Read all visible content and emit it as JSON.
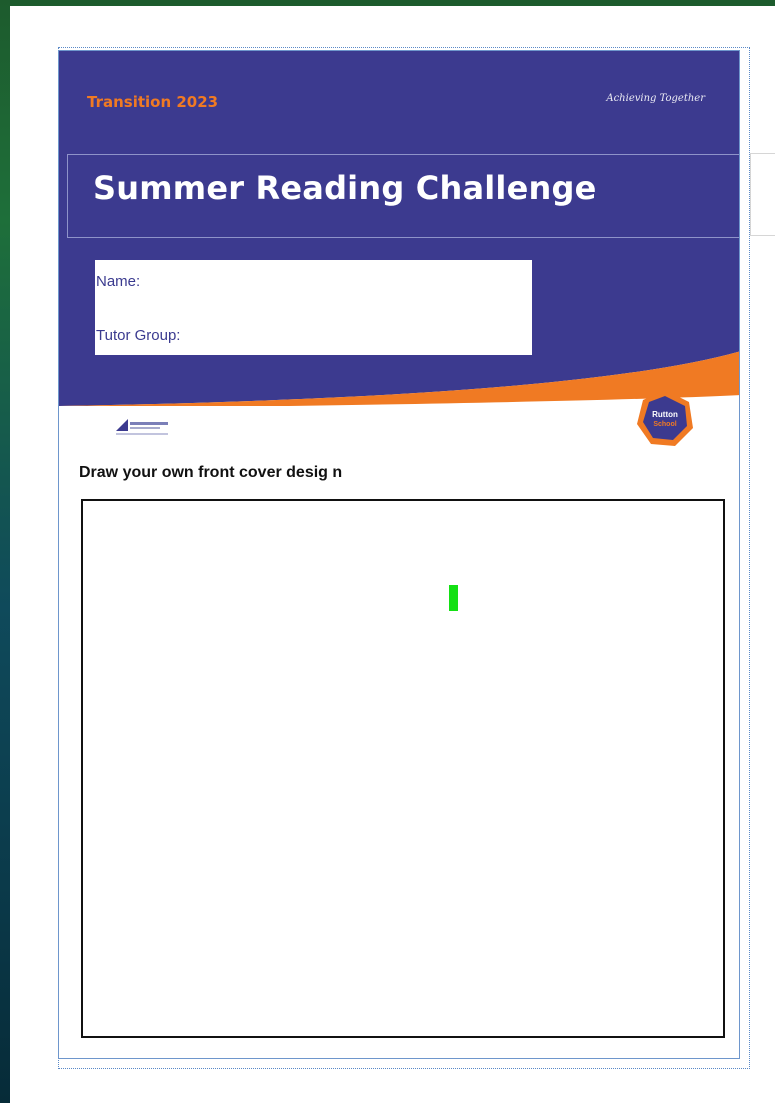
{
  "document": {
    "header": {
      "transition_label": "Transition 2023",
      "tagline": "Achieving Together",
      "title": "Summer Reading Challenge"
    },
    "form": {
      "name_label": "Name:",
      "tutor_group_label": "Tutor Group:"
    },
    "logos": {
      "right_logo_text_line1": "Rutton",
      "right_logo_text_line2": "School"
    },
    "instruction": "Draw your own front cover desig n"
  },
  "colors": {
    "header_navy": "#3c3a8f",
    "accent_orange": "#f07a23",
    "cursor_green": "#14e014"
  },
  "icons": {
    "left_logo": "school-trust-logo-icon",
    "right_logo": "school-crest-logo-icon"
  }
}
